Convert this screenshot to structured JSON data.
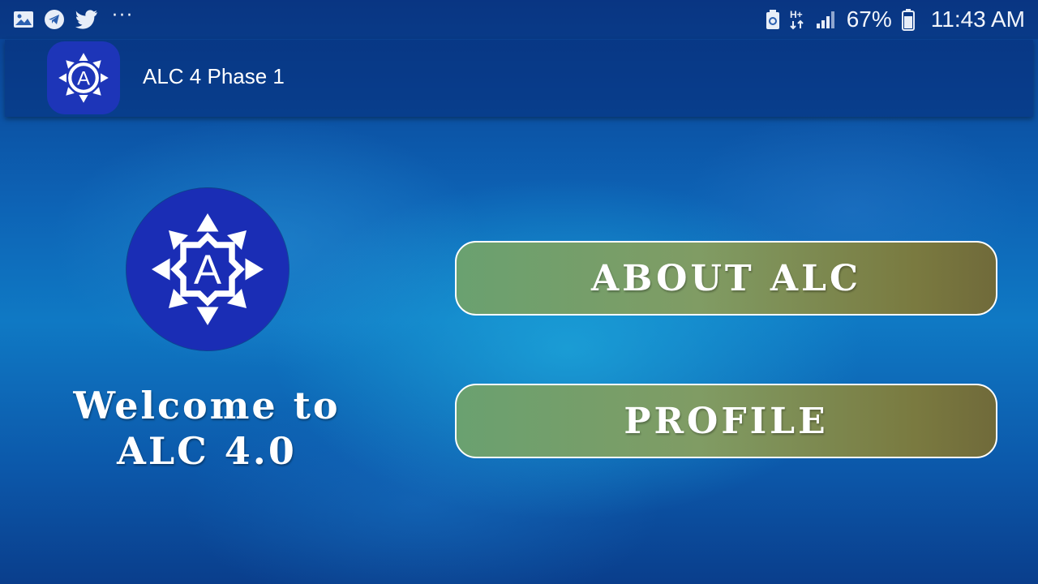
{
  "status_bar": {
    "left_icons": [
      "gallery-icon",
      "telegram-icon",
      "twitter-icon"
    ],
    "more_indicator": "···",
    "network_label": "H+",
    "battery_percent": "67%",
    "time": "11:43 AM"
  },
  "app_bar": {
    "icon": "alc-logo-icon",
    "title": "ALC 4 Phase 1"
  },
  "main": {
    "logo": "alc-logo-icon",
    "welcome_line1": "Welcome to",
    "welcome_line2": "ALC 4.0",
    "buttons": [
      {
        "label": "ABOUT ALC"
      },
      {
        "label": "PROFILE"
      }
    ]
  },
  "colors": {
    "logo_background": "#1a2db5",
    "button_gradient_start": "#6aa170",
    "button_gradient_end": "#706a3a",
    "background_primary": "#0d63b5"
  }
}
